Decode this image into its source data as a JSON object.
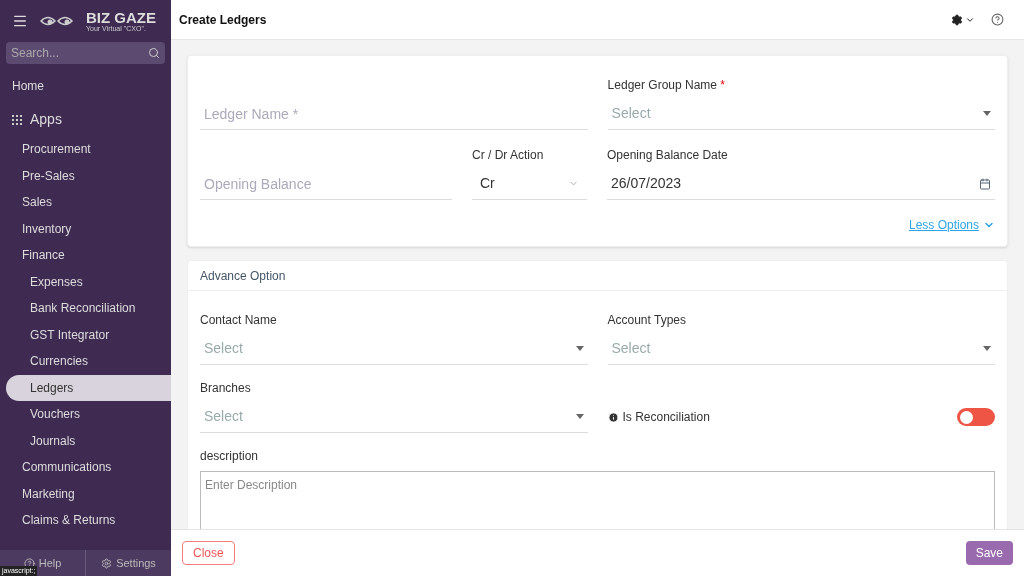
{
  "sidebar": {
    "logo": {
      "name": "BIZ GAZE",
      "tagline": "Your Virtual \"CXO\"."
    },
    "search": {
      "placeholder": "Search..."
    },
    "home": "Home",
    "apps": "Apps",
    "items": [
      {
        "label": "Procurement",
        "selected": false
      },
      {
        "label": "Pre-Sales",
        "selected": false
      },
      {
        "label": "Sales",
        "selected": false
      },
      {
        "label": "Inventory",
        "selected": false
      },
      {
        "label": "Finance",
        "selected": false,
        "children": [
          {
            "label": "Expenses",
            "selected": false
          },
          {
            "label": "Bank Reconciliation",
            "selected": false
          },
          {
            "label": "GST Integrator",
            "selected": false
          },
          {
            "label": "Currencies",
            "selected": false
          },
          {
            "label": "Ledgers",
            "selected": true
          },
          {
            "label": "Vouchers",
            "selected": false
          },
          {
            "label": "Journals",
            "selected": false
          }
        ]
      },
      {
        "label": "Communications",
        "selected": false
      },
      {
        "label": "Marketing",
        "selected": false
      },
      {
        "label": "Claims & Returns",
        "selected": false
      }
    ],
    "footer": [
      "Help",
      "Settings"
    ],
    "status_text": "javascript:;"
  },
  "header": {
    "title": "Create Ledgers"
  },
  "main_card": {
    "ledger_name": {
      "placeholder": "Ledger Name *"
    },
    "ledger_group": {
      "label": "Ledger Group Name",
      "required_mark": "*",
      "placeholder": "Select"
    },
    "opening_balance": {
      "placeholder": "Opening Balance"
    },
    "cr_dr": {
      "label": "Cr / Dr Action",
      "value": "Cr"
    },
    "opening_date": {
      "label": "Opening Balance Date",
      "value": "26/07/2023"
    },
    "less_options": "Less Options"
  },
  "advance_card": {
    "title": "Advance Option",
    "contact": {
      "label": "Contact Name",
      "placeholder": "Select"
    },
    "account_types": {
      "label": "Account Types",
      "placeholder": "Select"
    },
    "branches": {
      "label": "Branches",
      "placeholder": "Select"
    },
    "reconciliation": {
      "label": "Is Reconciliation",
      "on": false
    },
    "description": {
      "label": "description",
      "placeholder": "Enter Description"
    }
  },
  "footer": {
    "close": "Close",
    "save": "Save"
  }
}
